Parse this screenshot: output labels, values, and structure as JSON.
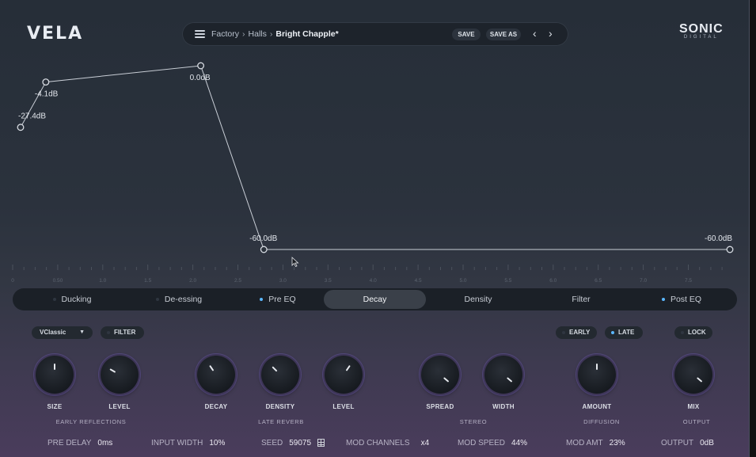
{
  "app": {
    "logo": "VELA",
    "brand_top": "SONIC",
    "brand_bottom": "DIGITAL"
  },
  "preset": {
    "crumbs": [
      "Factory",
      "Halls"
    ],
    "current": "Bright Chapple*",
    "save_label": "SAVE",
    "save_as_label": "SAVE AS"
  },
  "graph": {
    "points": [
      {
        "time": 0.0,
        "db": -27.4,
        "label": "-27.4dB"
      },
      {
        "time": 0.28,
        "db": -4.1,
        "label": "-4.1dB"
      },
      {
        "time": 2.0,
        "db": 0.0,
        "label": "0.0dB"
      },
      {
        "time": 2.7,
        "db": -60.0,
        "label": "-60.0dB"
      },
      {
        "time": 8.0,
        "db": -60.0,
        "label": "-60.0dB"
      }
    ],
    "ticks": [
      "0",
      "0.50",
      "1.0",
      "1.5",
      "2.0",
      "2.5",
      "3.0",
      "3.5",
      "4.0",
      "4.5",
      "5.0",
      "5.5",
      "6.0",
      "6.5",
      "7.0",
      "7.5"
    ]
  },
  "tabs": [
    {
      "label": "Ducking",
      "dot": "off"
    },
    {
      "label": "De-essing",
      "dot": "off"
    },
    {
      "label": "Pre EQ",
      "dot": "on"
    },
    {
      "label": "Decay",
      "dot": "none",
      "active": true
    },
    {
      "label": "Density",
      "dot": "none"
    },
    {
      "label": "Filter",
      "dot": "none"
    },
    {
      "label": "Post EQ",
      "dot": "on"
    }
  ],
  "controls": {
    "algorithm": "VClassic",
    "filter_label": "FILTER",
    "early_label": "EARLY",
    "late_label": "LATE",
    "lock_label": "LOCK"
  },
  "knobs": [
    {
      "label": "SIZE",
      "value_angle": 0
    },
    {
      "label": "LEVEL",
      "value_angle": -60
    },
    {
      "label": "DECAY",
      "value_angle": -35
    },
    {
      "label": "DENSITY",
      "value_angle": -45
    },
    {
      "label": "LEVEL",
      "value_angle": 35
    },
    {
      "label": "SPREAD",
      "value_angle": 130
    },
    {
      "label": "WIDTH",
      "value_angle": 130
    },
    {
      "label": "AMOUNT",
      "value_angle": 0
    },
    {
      "label": "MIX",
      "value_angle": 130
    }
  ],
  "sections": [
    "EARLY REFLECTIONS",
    "LATE REVERB",
    "STEREO",
    "DIFFUSION",
    "OUTPUT"
  ],
  "bottom": {
    "pre_delay_label": "PRE DELAY",
    "pre_delay_value": "0ms",
    "input_width_label": "INPUT WIDTH",
    "input_width_value": "10%",
    "seed_label": "SEED",
    "seed_value": "59075",
    "mod_channels_label": "MOD CHANNELS",
    "mod_channels_value": "x4",
    "mod_speed_label": "MOD SPEED",
    "mod_speed_value": "44%",
    "mod_amt_label": "MOD AMT",
    "mod_amt_value": "23%",
    "output_label": "OUTPUT",
    "output_value": "0dB"
  },
  "colors": {
    "accent": "#5bb8ff",
    "knob_ring": "#6e5bd0"
  }
}
